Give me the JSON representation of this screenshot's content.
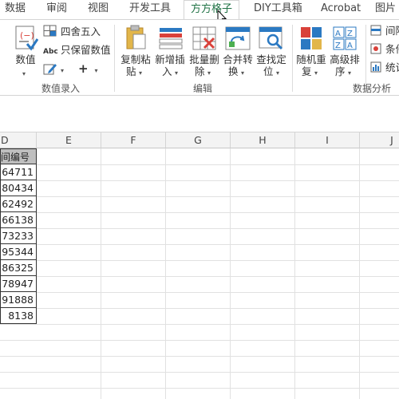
{
  "ribbon": {
    "tabs": [
      {
        "label": "数据"
      },
      {
        "label": "审阅"
      },
      {
        "label": "视图"
      },
      {
        "label": "开发工具"
      },
      {
        "label": "方方格子",
        "active": true
      },
      {
        "label": "DIY工具箱"
      },
      {
        "label": "Acrobat"
      },
      {
        "label": "图片"
      }
    ],
    "groups": {
      "numeric_entry": {
        "label": "数值录入",
        "value_button": "数值",
        "round_button": "四舍五入",
        "keep_values_button": "只保留数值"
      },
      "edit": {
        "label": "编辑",
        "copy_paste": [
          "复制粘",
          "贴"
        ],
        "new_insert": [
          "新增插",
          "入"
        ],
        "batch_delete": [
          "批量删",
          "除"
        ],
        "merge_convert": [
          "合并转",
          "换"
        ],
        "find_locate": [
          "查找定",
          "位"
        ]
      },
      "data_analysis": {
        "label": "数据分析",
        "random_repeat": [
          "随机重",
          "复"
        ],
        "advanced_sort": [
          "高级排",
          "序"
        ],
        "interval": "间隔",
        "conditional": "条件",
        "statistics": "统计"
      }
    }
  },
  "sheet": {
    "columns": [
      "D",
      "E",
      "F",
      "G",
      "H",
      "I",
      "J"
    ],
    "column_d_header": "间编号",
    "column_d_values": [
      "64711",
      "80434",
      "62492",
      "66138",
      "73233",
      "95344",
      "86325",
      "78947",
      "91888",
      "8138"
    ]
  },
  "colors": {
    "accent": "#217346",
    "header_fill": "#bfbfbf",
    "grid_line": "#e1e1e1"
  }
}
